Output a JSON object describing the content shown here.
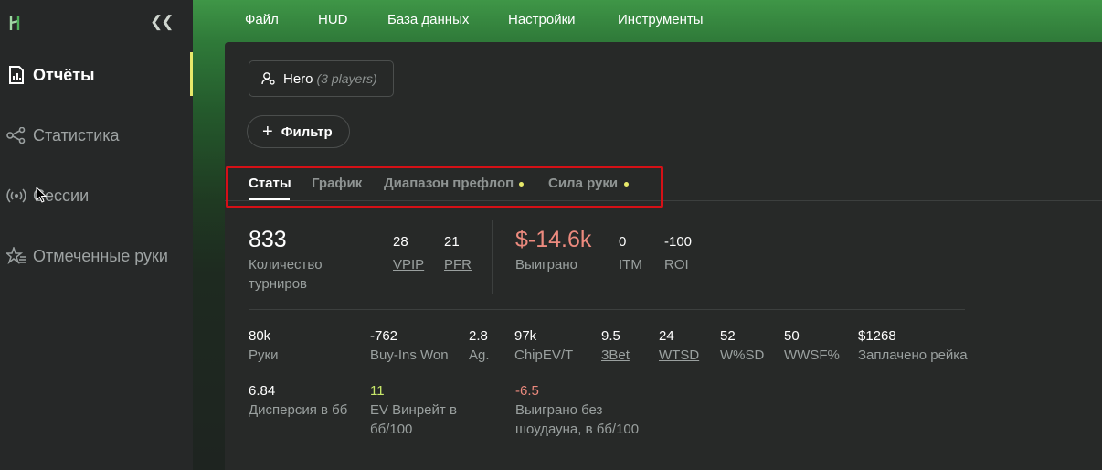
{
  "sidebar": {
    "items": [
      {
        "label": "Отчёты",
        "icon": "report-icon",
        "active": true
      },
      {
        "label": "Статистика",
        "icon": "share-nodes-icon",
        "active": false
      },
      {
        "label": "Сессии",
        "icon": "broadcast-icon",
        "active": false
      },
      {
        "label": "Отмеченные руки",
        "icon": "star-list-icon",
        "active": false
      }
    ]
  },
  "menu": [
    "Файл",
    "HUD",
    "База данных",
    "Настройки",
    "Инструменты"
  ],
  "hero": {
    "name": "Hero",
    "count": "(3 players)"
  },
  "filter": {
    "label": "Фильтр"
  },
  "tabs": [
    "Статы",
    "График",
    "Диапазон префлоп",
    "Сила руки"
  ],
  "summary": {
    "tournaments": {
      "value": "833",
      "label": "Количество турниров"
    },
    "vpip": {
      "value": "28",
      "label": "VPIP"
    },
    "pfr": {
      "value": "21",
      "label": "PFR"
    },
    "won": {
      "value": "$-14.6k",
      "label": "Выиграно"
    },
    "itm": {
      "value": "0",
      "label": "ITM"
    },
    "roi": {
      "value": "-100",
      "label": "ROI"
    }
  },
  "stats_row1": [
    {
      "value": "80k",
      "label": "Руки"
    },
    {
      "value": "-762",
      "label": "Buy-Ins Won"
    },
    {
      "value": "2.8",
      "label": "Ag."
    },
    {
      "value": "97k",
      "label": "ChipEV/T"
    },
    {
      "value": "9.5",
      "label": "3Bet"
    },
    {
      "value": "24",
      "label": "WTSD"
    },
    {
      "value": "52",
      "label": "W%SD"
    },
    {
      "value": "50",
      "label": "WWSF%"
    },
    {
      "value": "$1268",
      "label": "Заплачено рейка"
    }
  ],
  "stats_row2": [
    {
      "value": "6.84",
      "label_line1": "Дисперсия в бб",
      "label_line2": ""
    },
    {
      "value": "11",
      "label_line1": "EV Винрейт в",
      "label_line2": "бб/100"
    },
    {
      "value": "-6.5",
      "label_line1": "Выиграно без",
      "label_line2": "шоудауна, в бб/100"
    }
  ],
  "colors": {
    "accent": "#e7e96a",
    "negative": "#ec8a7e",
    "positive": "#c8e86a",
    "highlight": "#d51016"
  }
}
